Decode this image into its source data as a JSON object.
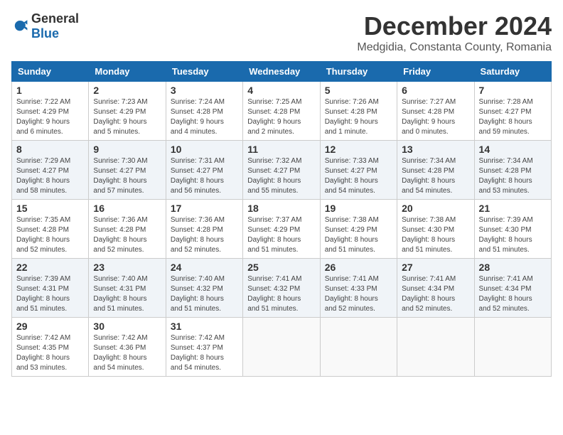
{
  "header": {
    "logo": {
      "general": "General",
      "blue": "Blue"
    },
    "title": "December 2024",
    "location": "Medgidia, Constanta County, Romania"
  },
  "calendar": {
    "days_of_week": [
      "Sunday",
      "Monday",
      "Tuesday",
      "Wednesday",
      "Thursday",
      "Friday",
      "Saturday"
    ],
    "weeks": [
      [
        null,
        {
          "day": "2",
          "sunrise": "Sunrise: 7:23 AM",
          "sunset": "Sunset: 4:29 PM",
          "daylight": "Daylight: 9 hours and 5 minutes."
        },
        {
          "day": "3",
          "sunrise": "Sunrise: 7:24 AM",
          "sunset": "Sunset: 4:28 PM",
          "daylight": "Daylight: 9 hours and 4 minutes."
        },
        {
          "day": "4",
          "sunrise": "Sunrise: 7:25 AM",
          "sunset": "Sunset: 4:28 PM",
          "daylight": "Daylight: 9 hours and 2 minutes."
        },
        {
          "day": "5",
          "sunrise": "Sunrise: 7:26 AM",
          "sunset": "Sunset: 4:28 PM",
          "daylight": "Daylight: 9 hours and 1 minute."
        },
        {
          "day": "6",
          "sunrise": "Sunrise: 7:27 AM",
          "sunset": "Sunset: 4:28 PM",
          "daylight": "Daylight: 9 hours and 0 minutes."
        },
        {
          "day": "7",
          "sunrise": "Sunrise: 7:28 AM",
          "sunset": "Sunset: 4:27 PM",
          "daylight": "Daylight: 8 hours and 59 minutes."
        }
      ],
      [
        {
          "day": "1",
          "sunrise": "Sunrise: 7:22 AM",
          "sunset": "Sunset: 4:29 PM",
          "daylight": "Daylight: 9 hours and 6 minutes."
        },
        null,
        null,
        null,
        null,
        null,
        null
      ],
      [
        {
          "day": "8",
          "sunrise": "Sunrise: 7:29 AM",
          "sunset": "Sunset: 4:27 PM",
          "daylight": "Daylight: 8 hours and 58 minutes."
        },
        {
          "day": "9",
          "sunrise": "Sunrise: 7:30 AM",
          "sunset": "Sunset: 4:27 PM",
          "daylight": "Daylight: 8 hours and 57 minutes."
        },
        {
          "day": "10",
          "sunrise": "Sunrise: 7:31 AM",
          "sunset": "Sunset: 4:27 PM",
          "daylight": "Daylight: 8 hours and 56 minutes."
        },
        {
          "day": "11",
          "sunrise": "Sunrise: 7:32 AM",
          "sunset": "Sunset: 4:27 PM",
          "daylight": "Daylight: 8 hours and 55 minutes."
        },
        {
          "day": "12",
          "sunrise": "Sunrise: 7:33 AM",
          "sunset": "Sunset: 4:27 PM",
          "daylight": "Daylight: 8 hours and 54 minutes."
        },
        {
          "day": "13",
          "sunrise": "Sunrise: 7:34 AM",
          "sunset": "Sunset: 4:28 PM",
          "daylight": "Daylight: 8 hours and 54 minutes."
        },
        {
          "day": "14",
          "sunrise": "Sunrise: 7:34 AM",
          "sunset": "Sunset: 4:28 PM",
          "daylight": "Daylight: 8 hours and 53 minutes."
        }
      ],
      [
        {
          "day": "15",
          "sunrise": "Sunrise: 7:35 AM",
          "sunset": "Sunset: 4:28 PM",
          "daylight": "Daylight: 8 hours and 52 minutes."
        },
        {
          "day": "16",
          "sunrise": "Sunrise: 7:36 AM",
          "sunset": "Sunset: 4:28 PM",
          "daylight": "Daylight: 8 hours and 52 minutes."
        },
        {
          "day": "17",
          "sunrise": "Sunrise: 7:36 AM",
          "sunset": "Sunset: 4:28 PM",
          "daylight": "Daylight: 8 hours and 52 minutes."
        },
        {
          "day": "18",
          "sunrise": "Sunrise: 7:37 AM",
          "sunset": "Sunset: 4:29 PM",
          "daylight": "Daylight: 8 hours and 51 minutes."
        },
        {
          "day": "19",
          "sunrise": "Sunrise: 7:38 AM",
          "sunset": "Sunset: 4:29 PM",
          "daylight": "Daylight: 8 hours and 51 minutes."
        },
        {
          "day": "20",
          "sunrise": "Sunrise: 7:38 AM",
          "sunset": "Sunset: 4:30 PM",
          "daylight": "Daylight: 8 hours and 51 minutes."
        },
        {
          "day": "21",
          "sunrise": "Sunrise: 7:39 AM",
          "sunset": "Sunset: 4:30 PM",
          "daylight": "Daylight: 8 hours and 51 minutes."
        }
      ],
      [
        {
          "day": "22",
          "sunrise": "Sunrise: 7:39 AM",
          "sunset": "Sunset: 4:31 PM",
          "daylight": "Daylight: 8 hours and 51 minutes."
        },
        {
          "day": "23",
          "sunrise": "Sunrise: 7:40 AM",
          "sunset": "Sunset: 4:31 PM",
          "daylight": "Daylight: 8 hours and 51 minutes."
        },
        {
          "day": "24",
          "sunrise": "Sunrise: 7:40 AM",
          "sunset": "Sunset: 4:32 PM",
          "daylight": "Daylight: 8 hours and 51 minutes."
        },
        {
          "day": "25",
          "sunrise": "Sunrise: 7:41 AM",
          "sunset": "Sunset: 4:32 PM",
          "daylight": "Daylight: 8 hours and 51 minutes."
        },
        {
          "day": "26",
          "sunrise": "Sunrise: 7:41 AM",
          "sunset": "Sunset: 4:33 PM",
          "daylight": "Daylight: 8 hours and 52 minutes."
        },
        {
          "day": "27",
          "sunrise": "Sunrise: 7:41 AM",
          "sunset": "Sunset: 4:34 PM",
          "daylight": "Daylight: 8 hours and 52 minutes."
        },
        {
          "day": "28",
          "sunrise": "Sunrise: 7:41 AM",
          "sunset": "Sunset: 4:34 PM",
          "daylight": "Daylight: 8 hours and 52 minutes."
        }
      ],
      [
        {
          "day": "29",
          "sunrise": "Sunrise: 7:42 AM",
          "sunset": "Sunset: 4:35 PM",
          "daylight": "Daylight: 8 hours and 53 minutes."
        },
        {
          "day": "30",
          "sunrise": "Sunrise: 7:42 AM",
          "sunset": "Sunset: 4:36 PM",
          "daylight": "Daylight: 8 hours and 54 minutes."
        },
        {
          "day": "31",
          "sunrise": "Sunrise: 7:42 AM",
          "sunset": "Sunset: 4:37 PM",
          "daylight": "Daylight: 8 hours and 54 minutes."
        },
        null,
        null,
        null,
        null
      ]
    ]
  }
}
